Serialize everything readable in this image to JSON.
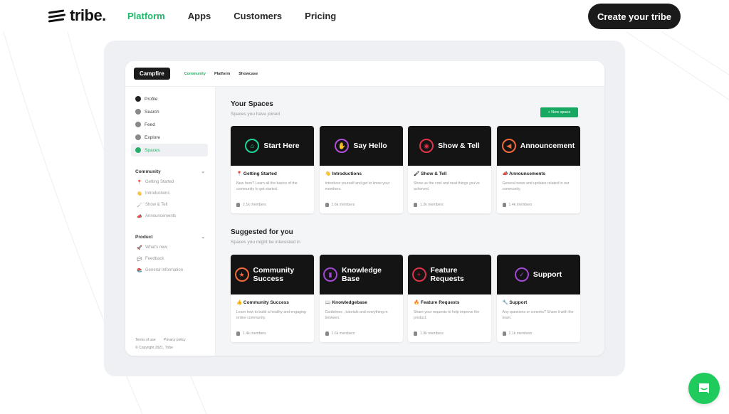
{
  "brand": {
    "name": "tribe.",
    "accent": "#1fb86a"
  },
  "nav": {
    "links": [
      {
        "label": "Platform",
        "active": true
      },
      {
        "label": "Apps",
        "active": false
      },
      {
        "label": "Customers",
        "active": false
      },
      {
        "label": "Pricing",
        "active": false
      }
    ],
    "cta_label": "Create your tribe"
  },
  "preview": {
    "app_logo": "Campfire",
    "tabs": [
      {
        "label": "Community",
        "active": true
      },
      {
        "label": "Platform",
        "active": false
      },
      {
        "label": "Showcase",
        "active": false
      }
    ],
    "sidebar": {
      "items": [
        {
          "label": "Profile",
          "icon": "avatar-icon",
          "color": "#222"
        },
        {
          "label": "Search",
          "icon": "search-icon",
          "color": "#888"
        },
        {
          "label": "Feed",
          "icon": "feed-icon",
          "color": "#888"
        },
        {
          "label": "Explore",
          "icon": "explore-icon",
          "color": "#888"
        },
        {
          "label": "Spaces",
          "icon": "spaces-icon",
          "color": "#26b16a",
          "active": true
        }
      ],
      "sections": [
        {
          "title": "Community",
          "items": [
            {
              "emoji": "📍",
              "label": "Getting Started"
            },
            {
              "emoji": "👋",
              "label": "Introductions"
            },
            {
              "emoji": "🖌",
              "label": "Show & Tell"
            },
            {
              "emoji": "📣",
              "label": "Announcements"
            }
          ]
        },
        {
          "title": "Product",
          "items": [
            {
              "emoji": "🚀",
              "label": "What's new"
            },
            {
              "emoji": "💬",
              "label": "Feedback"
            },
            {
              "emoji": "📚",
              "label": "General Information"
            }
          ]
        }
      ],
      "footer": {
        "terms": "Terms of use",
        "privacy": "Privacy policy",
        "copyright": "© Copyright 2021, Tribe"
      }
    },
    "your_spaces": {
      "title": "Your Spaces",
      "subtitle": "Spaces you have joined",
      "new_space_label": "+ New space",
      "cards": [
        {
          "banner": "Start Here",
          "icon": "home-icon",
          "glyph": "⌂",
          "ring": "#1fd39a",
          "emoji": "📍",
          "name": "Getting Started",
          "desc": "New here? Learn all the basics of the community to get started.",
          "members": "2.1k members"
        },
        {
          "banner": "Say Hello",
          "icon": "wave-person-icon",
          "glyph": "✋",
          "ring": "#b04fd6",
          "emoji": "👋",
          "name": "Introductions",
          "desc": "Introduce yourself and get to know your members.",
          "members": "1.6k members"
        },
        {
          "banner": "Show & Tell",
          "icon": "eye-icon",
          "glyph": "◉",
          "ring": "#e0334a",
          "emoji": "🖌",
          "name": "Show & Tell",
          "desc": "Show us the cool and neat things you've achieved.",
          "members": "1.2k members"
        },
        {
          "banner": "Announcement",
          "icon": "megaphone-icon",
          "glyph": "◀",
          "ring": "#f36a3a",
          "emoji": "📣",
          "name": "Announcements",
          "desc": "General news and updates related to our community.",
          "members": "1.4k members"
        }
      ]
    },
    "suggested": {
      "title": "Suggested for you",
      "subtitle": "Spaces you might be interested in",
      "cards": [
        {
          "banner": "Community Success",
          "icon": "star-icon",
          "glyph": "★",
          "ring": "#f36a3a",
          "emoji": "👍",
          "name": "Community Success",
          "desc": "Learn how to build a healthy and engaging online community.",
          "members": "1.4k members"
        },
        {
          "banner": "Knowledge Base",
          "icon": "book-icon",
          "glyph": "▮",
          "ring": "#a347d6",
          "emoji": "📖",
          "name": "Knowledgebase",
          "desc": "Guidelines , tutorials and everything in between.",
          "members": "1.6k members"
        },
        {
          "banner": "Feature Requests",
          "icon": "plus-icon",
          "glyph": "+",
          "ring": "#e0334a",
          "emoji": "🔥",
          "name": "Feature Requests",
          "desc": "Share your requests to help improve the product.",
          "members": "1.9k members"
        },
        {
          "banner": "Support",
          "icon": "check-icon",
          "glyph": "✓",
          "ring": "#a347d6",
          "emoji": "🔧",
          "name": "Support",
          "desc": "Any questions or conerns? Share it with the team.",
          "members": "2.1k members"
        }
      ]
    }
  }
}
